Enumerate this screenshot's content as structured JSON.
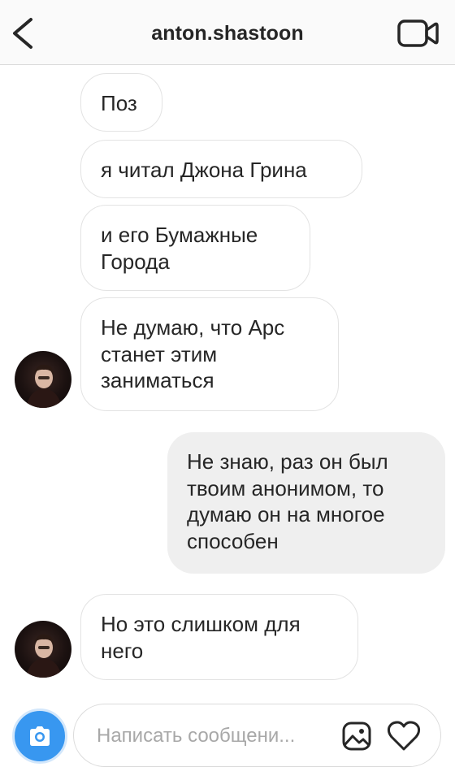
{
  "header": {
    "title": "anton.shastoon",
    "back_icon": "chevron-left-icon",
    "video_icon": "video-camera-icon"
  },
  "messages": [
    {
      "direction": "incoming",
      "text": "Поз"
    },
    {
      "direction": "incoming",
      "text": "я читал Джона Грина"
    },
    {
      "direction": "incoming",
      "text": "и его Бумажные\nГорода"
    },
    {
      "direction": "incoming",
      "text": "Не думаю, что Арс\nстанет этим\nзаниматься",
      "avatar": true
    },
    {
      "direction": "outgoing",
      "text": "Не знаю, раз он был\nтвоим анонимом, то\nдумаю он на многое\nспособен"
    },
    {
      "direction": "incoming",
      "text": "Но это слишком для\nнего",
      "avatar": true
    }
  ],
  "composer": {
    "placeholder": "Написать сообщени...",
    "value": "",
    "camera_icon": "camera-icon",
    "gallery_icon": "gallery-icon",
    "like_icon": "heart-icon"
  },
  "colors": {
    "accent": "#3897f0",
    "incoming_bubble": "#ffffff",
    "outgoing_bubble": "#efefef",
    "text": "#262626",
    "placeholder": "#a8a8a8"
  }
}
